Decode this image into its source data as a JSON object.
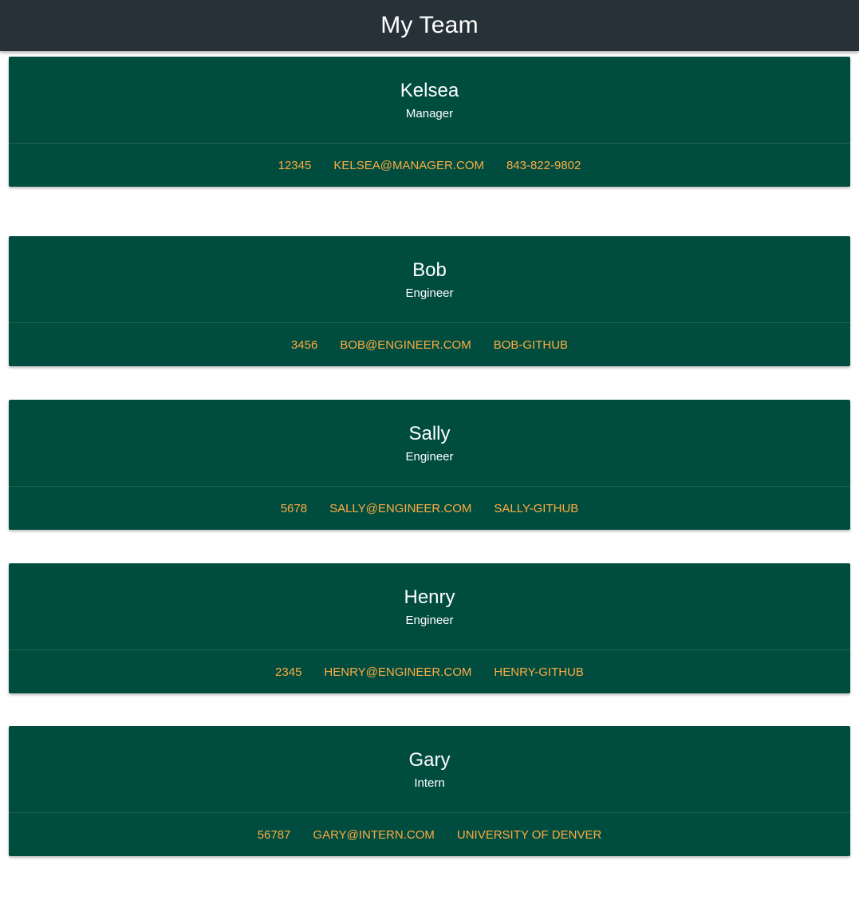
{
  "header": {
    "title": "My Team"
  },
  "colors": {
    "navbar": "#263238",
    "card": "#004d40",
    "link": "#ffab40",
    "text": "#ffffff"
  },
  "members": [
    {
      "name": "Kelsea",
      "role": "Manager",
      "id": "12345",
      "email": "KELSEA@MANAGER.COM",
      "extra": "843-822-9802"
    },
    {
      "name": "Bob",
      "role": "Engineer",
      "id": "3456",
      "email": "BOB@ENGINEER.COM",
      "extra": "BOB-GITHUB"
    },
    {
      "name": "Sally",
      "role": "Engineer",
      "id": "5678",
      "email": "SALLY@ENGINEER.COM",
      "extra": "SALLY-GITHUB"
    },
    {
      "name": "Henry",
      "role": "Engineer",
      "id": "2345",
      "email": "HENRY@ENGINEER.COM",
      "extra": "HENRY-GITHUB"
    },
    {
      "name": "Gary",
      "role": "Intern",
      "id": "56787",
      "email": "GARY@INTERN.COM",
      "extra": "UNIVERSITY OF DENVER"
    }
  ]
}
